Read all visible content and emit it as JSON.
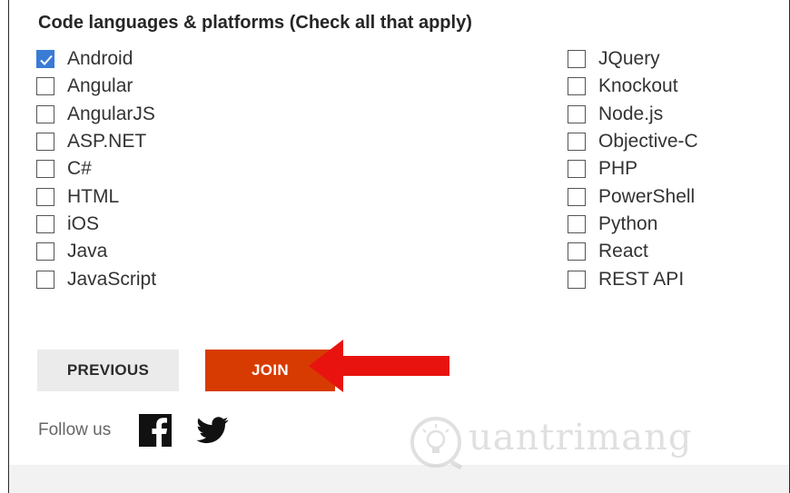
{
  "section": {
    "title": "Code languages & platforms (Check all that apply)"
  },
  "options_left": [
    {
      "label": "Android",
      "checked": true
    },
    {
      "label": "Angular",
      "checked": false
    },
    {
      "label": "AngularJS",
      "checked": false
    },
    {
      "label": "ASP.NET",
      "checked": false
    },
    {
      "label": "C#",
      "checked": false
    },
    {
      "label": "HTML",
      "checked": false
    },
    {
      "label": "iOS",
      "checked": false
    },
    {
      "label": "Java",
      "checked": false
    },
    {
      "label": "JavaScript",
      "checked": false
    }
  ],
  "options_right": [
    {
      "label": "JQuery",
      "checked": false
    },
    {
      "label": "Knockout",
      "checked": false
    },
    {
      "label": "Node.js",
      "checked": false
    },
    {
      "label": "Objective-C",
      "checked": false
    },
    {
      "label": "PHP",
      "checked": false
    },
    {
      "label": "PowerShell",
      "checked": false
    },
    {
      "label": "Python",
      "checked": false
    },
    {
      "label": "React",
      "checked": false
    },
    {
      "label": "REST API",
      "checked": false
    }
  ],
  "buttons": {
    "previous": "PREVIOUS",
    "join": "JOIN"
  },
  "social": {
    "follow_label": "Follow us",
    "icons": [
      "facebook-icon",
      "twitter-icon"
    ]
  },
  "watermark": {
    "text": "uantrimang"
  },
  "colors": {
    "accent": "#d83b01",
    "checkbox_checked": "#3a7bd5",
    "arrow": "#e8130f",
    "background_band": "#f2f2f2"
  }
}
